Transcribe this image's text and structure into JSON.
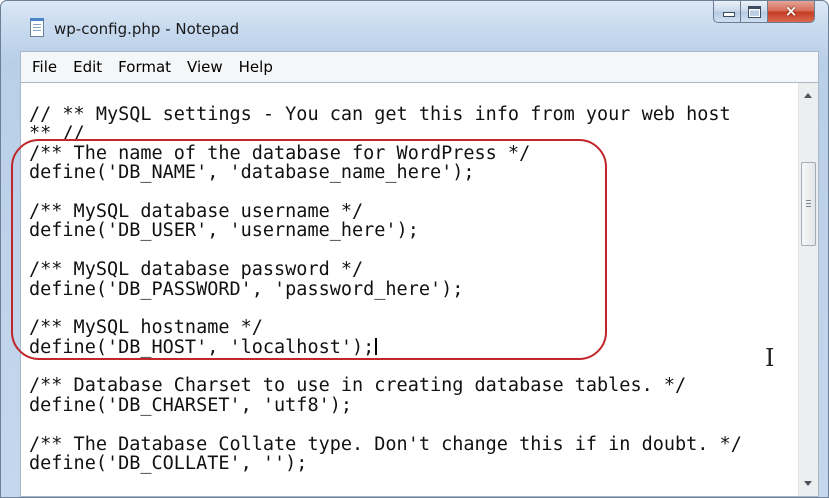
{
  "window": {
    "title": "wp-config.php - Notepad"
  },
  "menu": {
    "items": [
      "File",
      "Edit",
      "Format",
      "View",
      "Help"
    ]
  },
  "editor": {
    "lines": [
      "// ** MySQL settings - You can get this info from your web host",
      "** //",
      "/** The name of the database for WordPress */",
      "define('DB_NAME', 'database_name_here');",
      "",
      "/** MySQL database username */",
      "define('DB_USER', 'username_here');",
      "",
      "/** MySQL database password */",
      "define('DB_PASSWORD', 'password_here');",
      "",
      "/** MySQL hostname */",
      "define('DB_HOST', 'localhost');",
      "",
      "/** Database Charset to use in creating database tables. */",
      "define('DB_CHARSET', 'utf8');",
      "",
      "/** The Database Collate type. Don't change this if in doubt. */",
      "define('DB_COLLATE', '');"
    ],
    "caret_line": 12
  },
  "highlight": {
    "color": "#c0262b"
  },
  "icons": {
    "app": "notepad-icon",
    "minimize": "minimize-icon",
    "maximize": "maximize-icon",
    "close": "close-icon",
    "cursor": "text-cursor-icon"
  },
  "colors": {
    "close_button": "#c53a20",
    "titlebar": "#c6d9ee"
  }
}
